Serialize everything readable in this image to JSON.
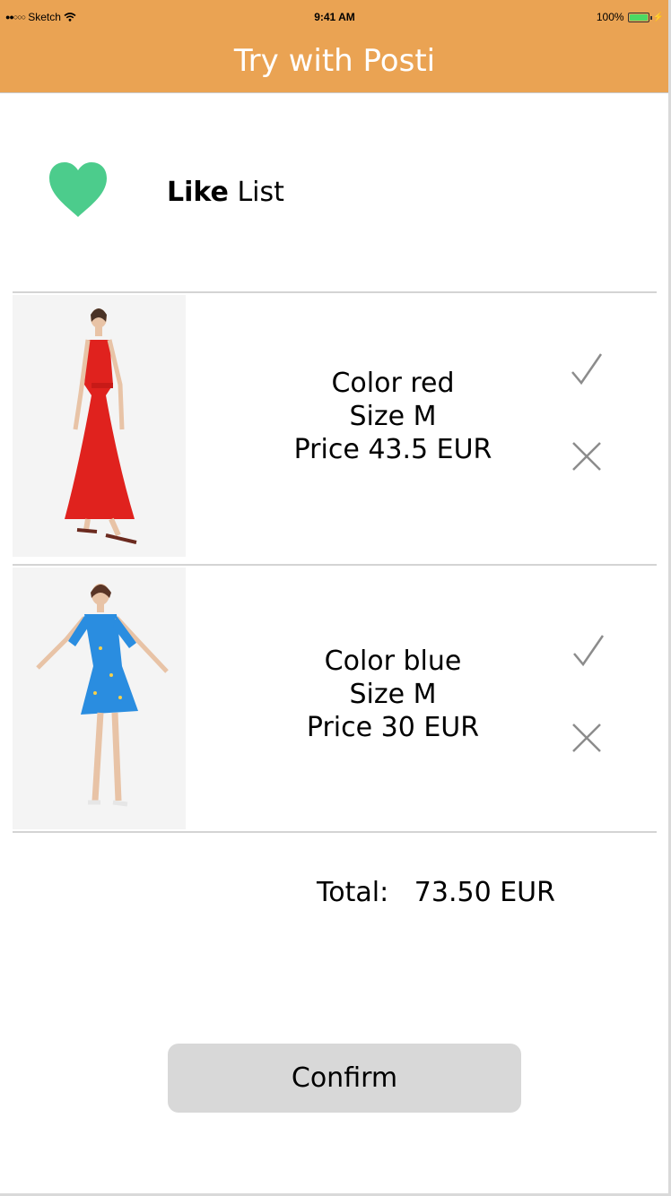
{
  "status_bar": {
    "carrier": "Sketch",
    "time": "9:41 AM",
    "battery": "100%"
  },
  "nav": {
    "title": "Try with Posti"
  },
  "like_list": {
    "title_bold": "Like",
    "title_rest": " List",
    "heart_color": "#4ccc8c"
  },
  "items": [
    {
      "color": "Color red",
      "size": "Size M",
      "price": "Price 43.5 EUR",
      "dress_color": "#e0221e"
    },
    {
      "color": "Color blue",
      "size": "Size M",
      "price": "Price 30 EUR",
      "dress_color": "#2a8de0"
    }
  ],
  "total": {
    "label": "Total:",
    "value": "73.50 EUR"
  },
  "confirm_label": "Confirm",
  "colors": {
    "accent": "#eaa353",
    "button": "#d8d8d8",
    "divider": "#d4d4d4"
  }
}
